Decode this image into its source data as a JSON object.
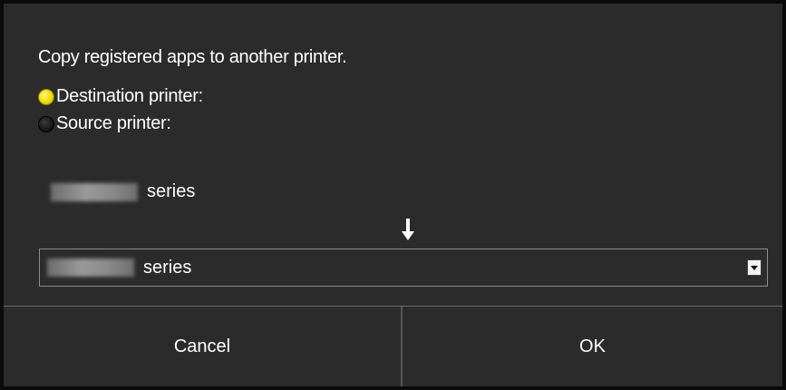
{
  "dialog": {
    "message": "Copy registered apps to another printer.",
    "options": [
      {
        "label": "Destination printer:",
        "selected": true
      },
      {
        "label": "Source printer:",
        "selected": false
      }
    ],
    "source_printer_suffix": "series",
    "target_select": {
      "selected_suffix": "series"
    },
    "arrow_icon": "down-arrow-icon",
    "buttons": {
      "cancel_label": "Cancel",
      "ok_label": "OK"
    }
  },
  "colors": {
    "background": "#2b2b2b",
    "border": "#0a0a0a",
    "text": "#ffffff",
    "radio_selected": "#f7e400"
  }
}
